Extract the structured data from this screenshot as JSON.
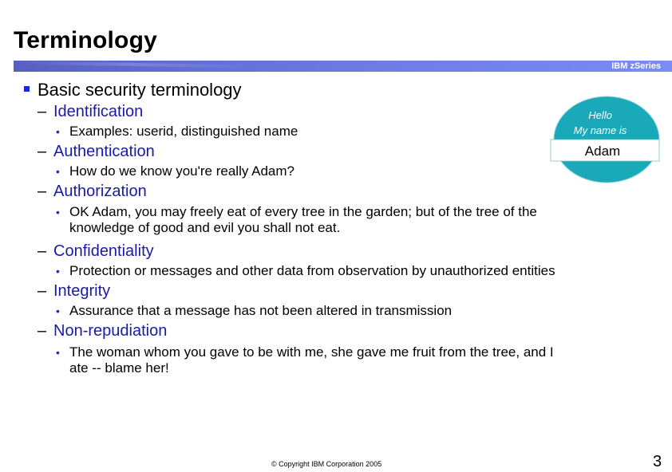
{
  "slide": {
    "title": "Terminology",
    "brand": "IBM zSeries",
    "heading": "Basic security terminology",
    "terms": [
      {
        "term": "Identification",
        "details": [
          "Examples: userid, distinguished name"
        ]
      },
      {
        "term": "Authentication",
        "details": [
          "How do we know you're really Adam?"
        ]
      },
      {
        "term": "Authorization",
        "details": [
          "OK Adam, you may freely eat of every tree in the garden; but of the tree of the",
          "knowledge of good and evil you shall not eat."
        ]
      },
      {
        "term": "Confidentiality",
        "details": [
          "Protection or messages and other data from observation by unauthorized entities"
        ]
      },
      {
        "term": "Integrity",
        "details": [
          "Assurance that a message has not been altered in transmission"
        ]
      },
      {
        "term": "Non-repudiation",
        "details": [
          "The woman whom you gave to be with me, she gave me fruit from the tree, and I",
          "ate -- blame her!"
        ]
      }
    ],
    "name_tag": {
      "line1": "Hello",
      "line2": "My name is",
      "name": "Adam",
      "color": "#1aa9b8"
    },
    "footer": "© Copyright IBM Corporation 2005",
    "page_number": "3"
  }
}
